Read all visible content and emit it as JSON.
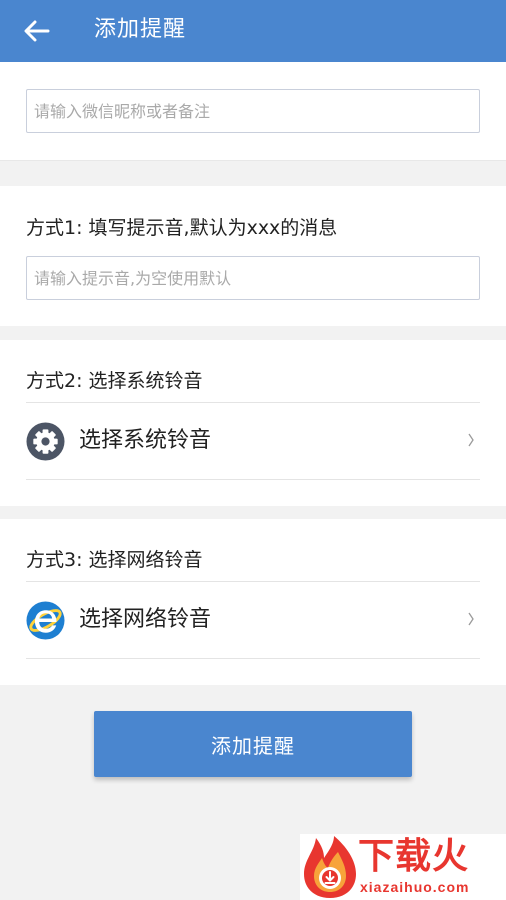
{
  "appbar": {
    "title": "添加提醒",
    "back_icon": "arrow-left-icon"
  },
  "name_input": {
    "value": "",
    "placeholder": "请输入微信昵称或者备注"
  },
  "method1": {
    "heading": "方式1: 填写提示音,默认为xxx的消息",
    "input_value": "",
    "input_placeholder": "请输入提示音,为空使用默认"
  },
  "method2": {
    "heading": "方式2: 选择系统铃音",
    "option_label": "选择系统铃音",
    "icon": "gear-icon"
  },
  "method3": {
    "heading": "方式3: 选择网络铃音",
    "option_label": "选择网络铃音",
    "icon": "internet-explorer-icon"
  },
  "submit_button": {
    "label": "添加提醒"
  },
  "watermark": {
    "title": "下载火",
    "url": "xiazaihuo.com"
  },
  "colors": {
    "primary": "#4a86cf",
    "background": "#f2f2f2",
    "watermark": "#e8362f"
  }
}
